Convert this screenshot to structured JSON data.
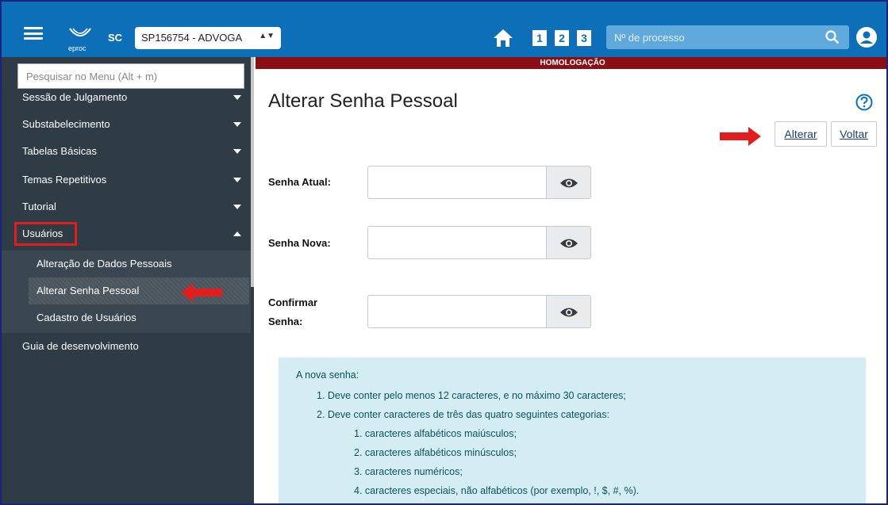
{
  "header": {
    "logo_text": "eproc",
    "sc_label": "SC",
    "org_select_value": "SP156754 - ADVOGA",
    "degree_buttons": [
      "1",
      "2",
      "3"
    ],
    "process_search_placeholder": "Nº de processo"
  },
  "sidebar": {
    "search_placeholder": "Pesquisar no Menu (Alt + m)",
    "items": [
      {
        "label": "Sessão de Julgamento"
      },
      {
        "label": "Substabelecimento"
      },
      {
        "label": "Tabelas Básicas"
      },
      {
        "label": "Temas Repetitivos"
      },
      {
        "label": "Tutorial"
      },
      {
        "label": "Usuários"
      },
      {
        "label": "Guia de desenvolvimento"
      }
    ],
    "submenu": [
      {
        "label": "Alteração de Dados Pessoais"
      },
      {
        "label": "Alterar Senha Pessoal"
      },
      {
        "label": "Cadastro de Usuários"
      }
    ]
  },
  "environment_banner": "HOMOLOGAÇÃO",
  "main": {
    "title": "Alterar Senha Pessoal",
    "buttons": {
      "alterar": "Alterar",
      "voltar": "Voltar"
    },
    "fields": {
      "current_password_label": "Senha Atual:",
      "new_password_label": "Senha Nova:",
      "confirm_password_label_line1": "Confirmar",
      "confirm_password_label_line2": "Senha:"
    },
    "info": {
      "heading": "A nova senha:",
      "rules": [
        "1. Deve conter pelo menos 12 caracteres, e no máximo 30 caracteres;",
        "2. Deve conter caracteres de três das quatro seguintes categorias:"
      ],
      "categories": [
        "1. caracteres alfabéticos maiúsculos;",
        "2. caracteres alfabéticos minúsculos;",
        "3. caracteres numéricos;",
        "4. caracteres especiais, não alfabéticos (por exemplo, !, $, #, %)."
      ]
    }
  },
  "colors": {
    "topbar": "#0d6fb8",
    "sidebar": "#2f3b45",
    "banner": "#8b0e14",
    "info_bg": "#d3edf2",
    "annotation": "#e01e1e"
  },
  "icons": [
    "hamburger-icon",
    "eproc-logo",
    "home-icon",
    "search-icon",
    "user-icon",
    "help-icon",
    "eye-icon",
    "chevron-down-icon",
    "chevron-up-icon",
    "arrow-annotation"
  ]
}
